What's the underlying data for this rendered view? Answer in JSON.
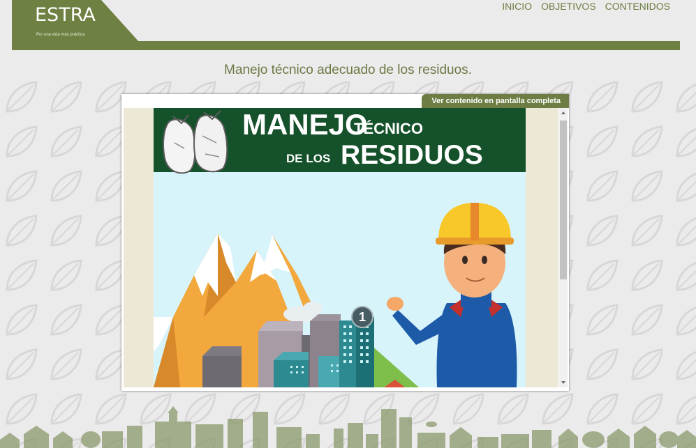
{
  "header": {
    "logo": "ESTRA",
    "tagline": "Por una vida más práctica",
    "nav": [
      "INICIO",
      "OBJETIVOS",
      "CONTENIDOS"
    ]
  },
  "page": {
    "title": "Manejo técnico adecuado de los residuos."
  },
  "embed": {
    "fullscreen_label": "Ver contenido en pantalla completa",
    "slide": {
      "title_line1": "MANEJO",
      "title_line1b": "TÉCNICO",
      "title_line2a": "DE LOS",
      "title_line2b": "RESIDUOS",
      "badge_number": "1"
    }
  },
  "colors": {
    "brand_green": "#6e8042",
    "slide_header": "#15512a",
    "slide_sky": "#d7f4fb"
  }
}
